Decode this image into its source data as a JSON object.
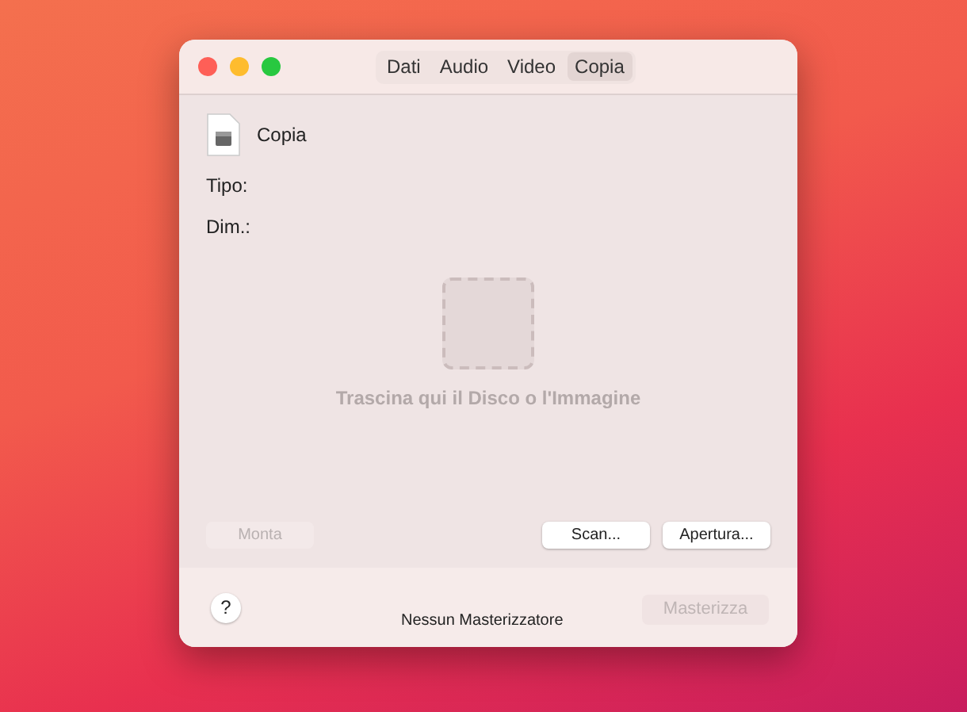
{
  "tabs": [
    {
      "label": "Dati",
      "selected": false
    },
    {
      "label": "Audio",
      "selected": false
    },
    {
      "label": "Video",
      "selected": false
    },
    {
      "label": "Copia",
      "selected": true
    }
  ],
  "file": {
    "name": "Copia"
  },
  "fields": [
    {
      "label": "Tipo:"
    },
    {
      "label": "Dim.:"
    }
  ],
  "drop_zone": {
    "text": "Trascina qui il Disco o l'Immagine"
  },
  "buttons": [
    {
      "label": "Monta",
      "disabled": true
    },
    {
      "label": "Scan...",
      "disabled": false
    },
    {
      "label": "Apertura...",
      "disabled": false
    }
  ],
  "footer": {
    "help": "?",
    "status": "Nessun Masterizzatore",
    "burn": {
      "label": "Masterizza",
      "disabled": true
    }
  }
}
